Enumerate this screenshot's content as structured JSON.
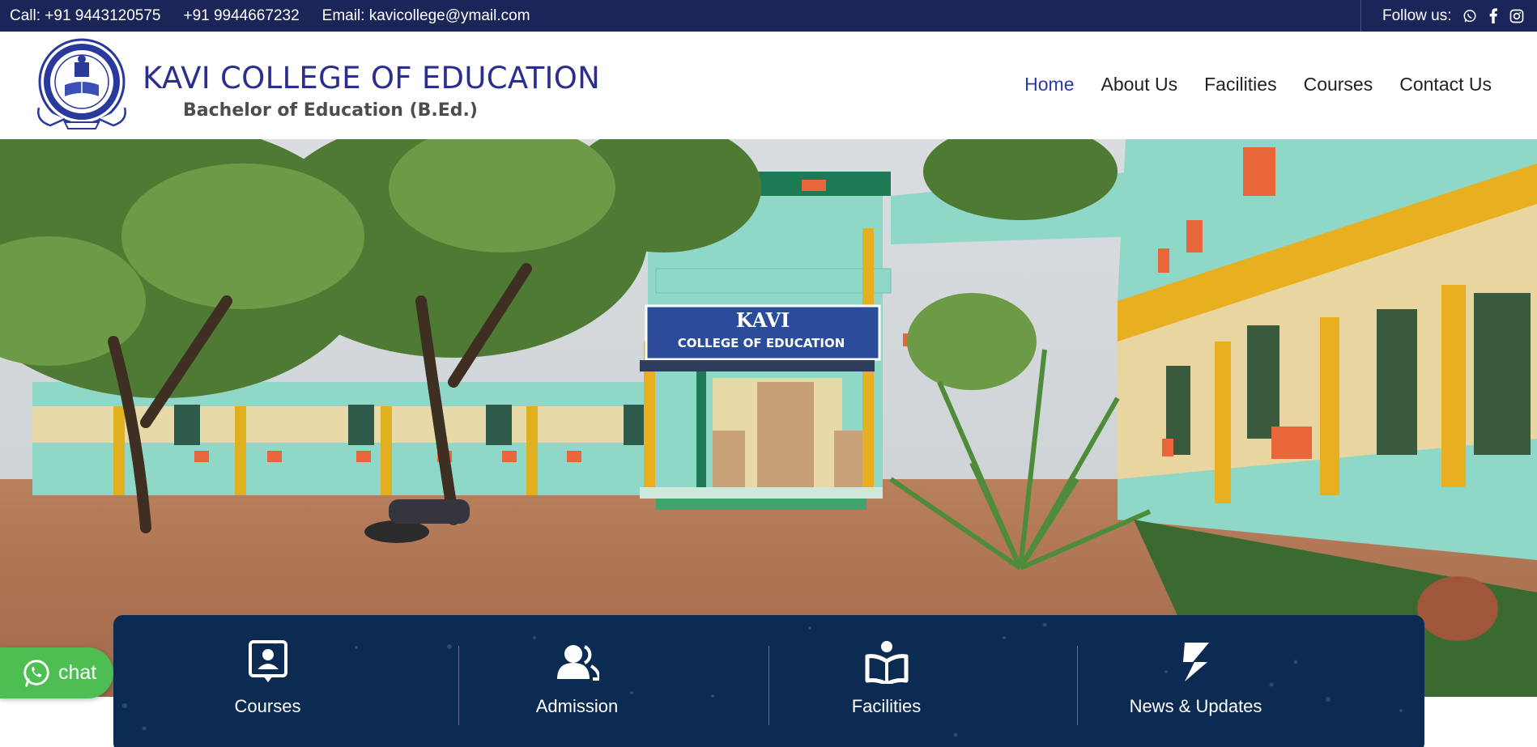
{
  "topbar": {
    "call": "Call: +91 9443120575",
    "phone2": "+91 9944667232",
    "email": "Email: kavicollege@ymail.com",
    "follow_label": "Follow us:",
    "social_icons": [
      "whatsapp-icon",
      "facebook-icon",
      "instagram-icon"
    ]
  },
  "header": {
    "title": "KAVI COLLEGE OF EDUCATION",
    "subtitle": "Bachelor of Education (B.Ed.)"
  },
  "nav": {
    "items": [
      {
        "label": "Home",
        "active": true
      },
      {
        "label": "About Us"
      },
      {
        "label": "Facilities"
      },
      {
        "label": "Courses"
      },
      {
        "label": "Contact Us"
      }
    ]
  },
  "hero": {
    "sign_line1": "KAVI",
    "sign_line2": "COLLEGE OF EDUCATION"
  },
  "features": [
    {
      "label": "Courses",
      "icon": "contact-card-icon"
    },
    {
      "label": "Admission",
      "icon": "users-icon"
    },
    {
      "label": "Facilities",
      "icon": "book-reader-icon"
    },
    {
      "label": "News & Updates",
      "icon": "updates-icon"
    }
  ],
  "chat": {
    "label": "chat",
    "icon": "whatsapp-icon"
  },
  "colors": {
    "topbar": "#1c2558",
    "brand": "#2a2f8f",
    "nav_active": "#2b3aa0",
    "panel": "#0b2b52",
    "chat": "#4dbf52"
  }
}
